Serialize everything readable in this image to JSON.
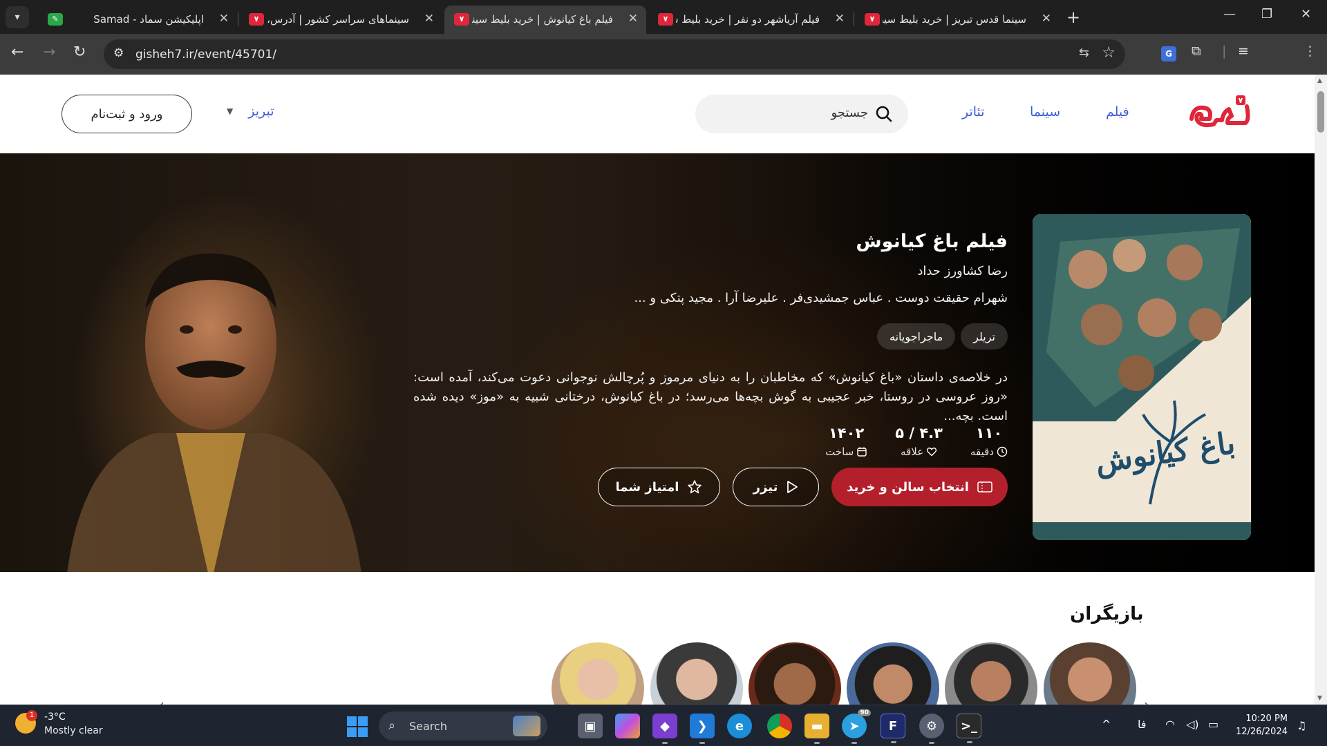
{
  "browser": {
    "tabs": [
      {
        "title": "اپلیکیشن سماد - Samad",
        "active": false
      },
      {
        "title": "سینماهای سراسر کشور | آدرس، تلفن",
        "active": false
      },
      {
        "title": "فیلم باغ کیانوش | خرید بلیط سینما",
        "active": true
      },
      {
        "title": "فیلم آریاشهر دو نفر | خرید بلیط سینما",
        "active": false
      },
      {
        "title": "سینما قدس تبریز | خرید بلیط سینما",
        "active": false
      }
    ],
    "url": "gisheh7.ir/event/45701/"
  },
  "site": {
    "logo_text": "گیشه ۷",
    "nav": {
      "film": "فیلم",
      "cinema": "سینما",
      "theater": "تئاتر"
    },
    "search_placeholder": "جستجو",
    "city": "تبریز",
    "login_label": "ورود و ثبت‌نام"
  },
  "movie": {
    "title": "فیلم باغ کیانوش",
    "director": "رضا کشاورز حداد",
    "cast_line": "شهرام حقیقت دوست . عباس جمشیدی‌فر . علیرضا آرا . مجید پتکی و ...",
    "tags": [
      "تریلر",
      "ماجراجویانه"
    ],
    "synopsis": "در خلاصه‌ی داستان «باغ کیانوش» که مخاطبان را به دنیای مرموز و پُرچالش نوجوانی دعوت می‌کند، آمده است: «روز عروسی در روستا، خبر عجیبی به گوش بچه‌ها می‌رسد؛ در باغ کیانوش، درختانی شبیه به «موز» دیده شده است. بچه...",
    "stats": [
      {
        "value": "۱۱۰",
        "label": "دقیقه",
        "icon": "clock-icon"
      },
      {
        "value": "۴.۳ / ۵",
        "label": "علاقه",
        "icon": "heart-icon"
      },
      {
        "value": "۱۴۰۲",
        "label": "ساخت",
        "icon": "calendar-icon"
      }
    ],
    "buttons": {
      "buy": "انتخاب سالن و خرید",
      "trailer": "تیزر",
      "rate": "امتیاز شما"
    },
    "poster_title": "باغ کیانوش"
  },
  "cast_section": {
    "title": "بازیگران"
  },
  "taskbar": {
    "weather_temp": "-3°C",
    "weather_cond": "Mostly clear",
    "weather_badge": "1",
    "search_label": "Search",
    "telegram_badge": "90",
    "lang": "فا",
    "time": "10:20 PM",
    "date": "12/26/2024"
  },
  "colors": {
    "brand_red": "#b3202c",
    "nav_blue": "#3b5bdb",
    "taskbar": "#1e2430"
  }
}
